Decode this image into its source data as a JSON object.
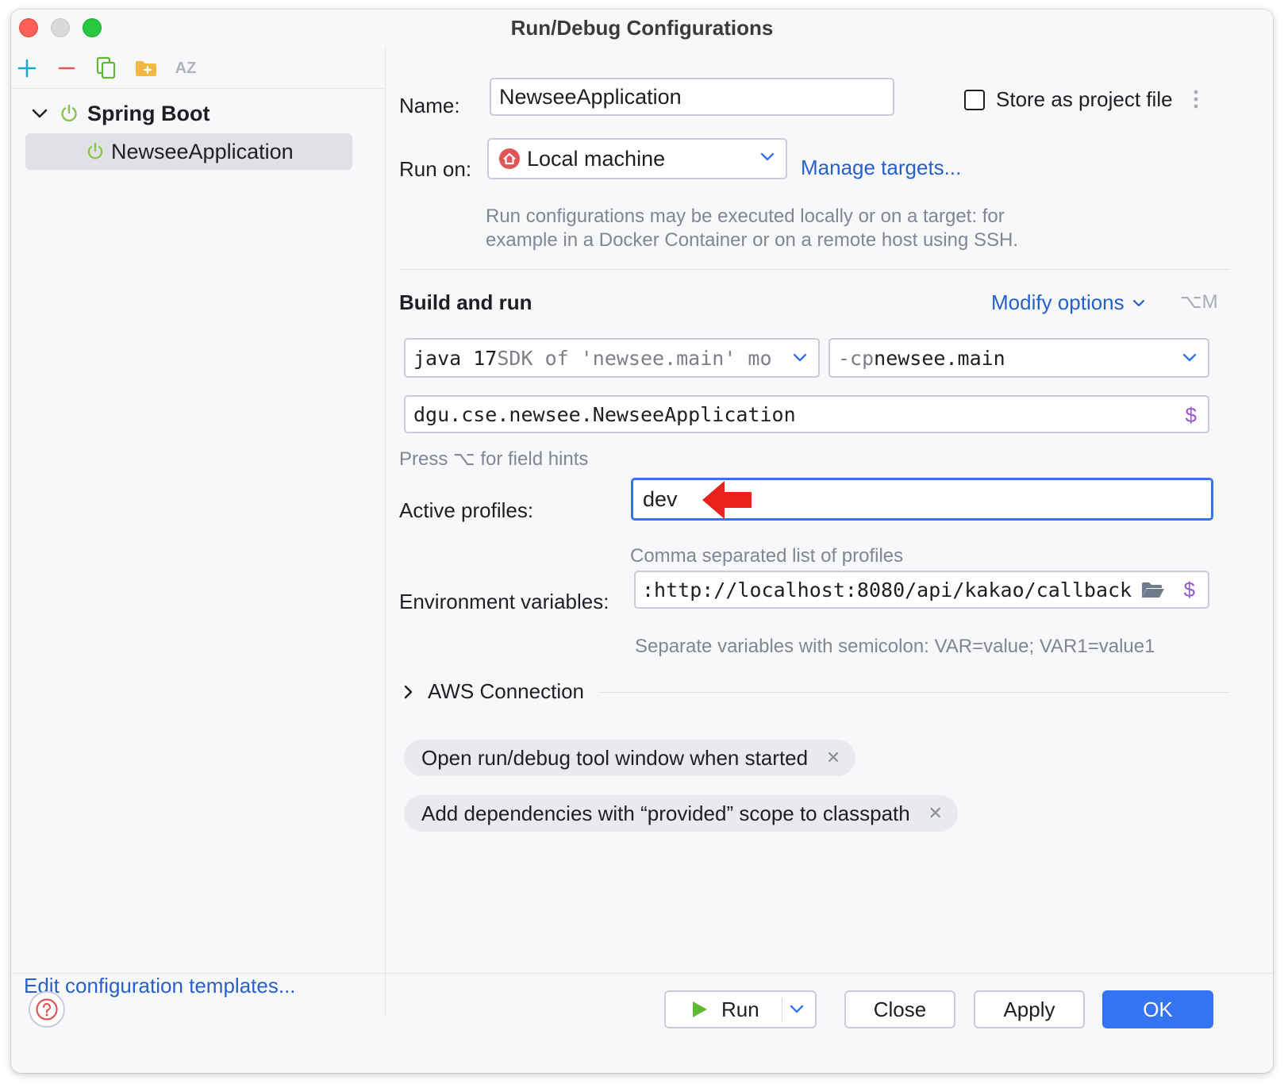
{
  "window": {
    "title": "Run/Debug Configurations"
  },
  "sidebar": {
    "group_label": "Spring Boot",
    "item_label": "NewseeApplication",
    "edit_templates_link": "Edit configuration templates...",
    "sort_label": "AZ"
  },
  "form": {
    "name_label": "Name:",
    "name_value": "NewseeApplication",
    "store_label": "Store as project file",
    "run_on_label": "Run on:",
    "run_on_value": "Local machine",
    "manage_targets": "Manage targets...",
    "run_on_hint_line1": "Run configurations may be executed locally or on a target: for",
    "run_on_hint_line2": "example in a Docker Container or on a remote host using SSH.",
    "build_run_title": "Build and run",
    "modify_options": "Modify options",
    "modify_shortcut": "⌥M",
    "jdk_main": "java 17",
    "jdk_detail": " SDK of 'newsee.main' mo",
    "cp_flag": "-cp",
    "cp_value": " newsee.main",
    "main_class": "dgu.cse.newsee.NewseeApplication",
    "field_hint": "Press ⌥ for field hints",
    "active_profiles_label": "Active profiles:",
    "active_profiles_value": "dev",
    "active_profiles_hint": "Comma separated list of profiles",
    "env_label": "Environment variables:",
    "env_value": ":http://localhost:8080/api/kakao/callback",
    "env_hint": "Separate variables with semicolon: VAR=value; VAR1=value1",
    "aws_label": "AWS Connection",
    "chips": [
      "Open run/debug tool window when started",
      "Add dependencies with “provided” scope to classpath"
    ]
  },
  "footer": {
    "run": "Run",
    "close": "Close",
    "apply": "Apply",
    "ok": "OK"
  },
  "colors": {
    "accent": "#3574f0",
    "link": "#2860c9",
    "spring_green": "#8bc34a",
    "annotation_arrow": "#e8221c"
  }
}
